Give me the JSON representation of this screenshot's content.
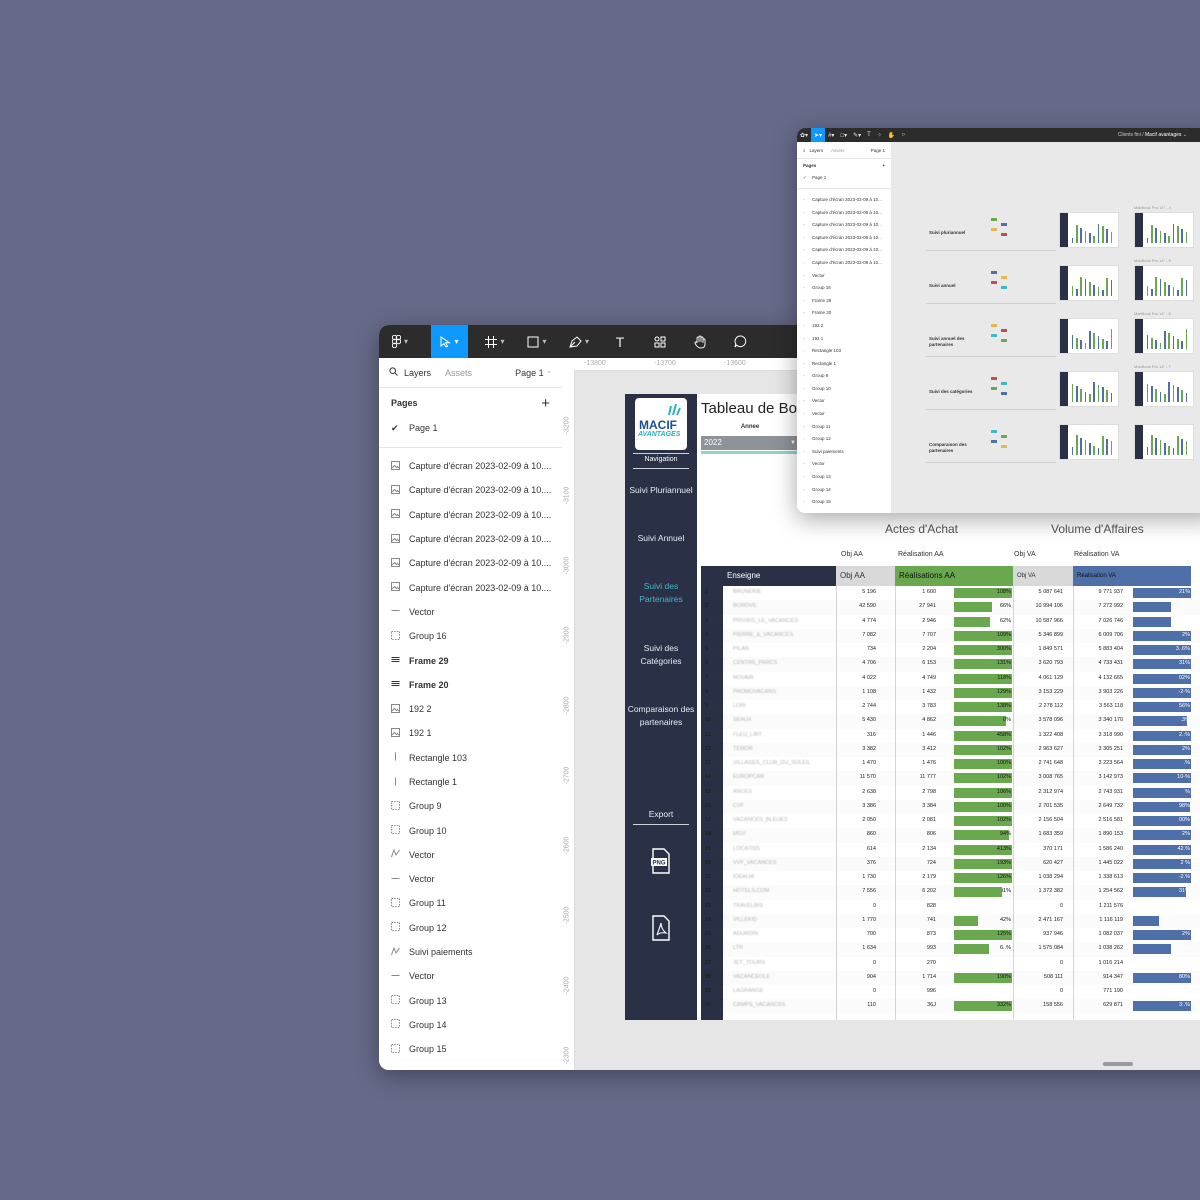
{
  "main_window": {
    "toolbar": {
      "tools": [
        {
          "name": "figma-menu",
          "icon": "figma-logo-icon"
        },
        {
          "name": "move-tool",
          "icon": "cursor-arrow-icon"
        },
        {
          "name": "frame-tool",
          "icon": "frame-hash-icon"
        },
        {
          "name": "shape-tool",
          "icon": "rectangle-icon"
        },
        {
          "name": "pen-tool",
          "icon": "pen-icon"
        },
        {
          "name": "text-tool",
          "label": "T"
        },
        {
          "name": "resources-tool",
          "icon": "components-icon"
        },
        {
          "name": "hand-tool",
          "icon": "hand-icon"
        },
        {
          "name": "comment-tool",
          "icon": "comment-icon"
        }
      ]
    },
    "left_panel": {
      "tab_layers": "Layers",
      "tab_assets": "Assets",
      "page_selector": "Page 1",
      "pages_header": "Pages",
      "pages": [
        "Page 1"
      ],
      "layers": [
        {
          "label": "Capture d'écran 2023-02-09 à 10....",
          "icon": "image-icon",
          "bold": false
        },
        {
          "label": "Capture d'écran 2023-02-09 à 10....",
          "icon": "image-icon",
          "bold": false
        },
        {
          "label": "Capture d'écran 2023-02-09 à 10....",
          "icon": "image-icon",
          "bold": false
        },
        {
          "label": "Capture d'écran 2023-02-09 à 10....",
          "icon": "image-icon",
          "bold": false
        },
        {
          "label": "Capture d'écran 2023-02-09 à 10....",
          "icon": "image-icon",
          "bold": false
        },
        {
          "label": "Capture d'écran 2023-02-09 à 10....",
          "icon": "image-icon",
          "bold": false
        },
        {
          "label": "Vector",
          "icon": "line-icon",
          "bold": false
        },
        {
          "label": "Group 16",
          "icon": "group-icon",
          "bold": false
        },
        {
          "label": "Frame 29",
          "icon": "frame-icon",
          "bold": true
        },
        {
          "label": "Frame 20",
          "icon": "frame-icon",
          "bold": true
        },
        {
          "label": "192 2",
          "icon": "image-icon",
          "bold": false
        },
        {
          "label": "192 1",
          "icon": "image-icon",
          "bold": false
        },
        {
          "label": "Rectangle 103",
          "icon": "rectangle-thin-icon",
          "bold": false
        },
        {
          "label": "Rectangle 1",
          "icon": "rectangle-thin-icon",
          "bold": false
        },
        {
          "label": "Group 9",
          "icon": "group-icon",
          "bold": false
        },
        {
          "label": "Group 10",
          "icon": "group-icon",
          "bold": false
        },
        {
          "label": "Vector",
          "icon": "vector-path-icon",
          "bold": false
        },
        {
          "label": "Vector",
          "icon": "line-icon",
          "bold": false
        },
        {
          "label": "Group 11",
          "icon": "group-icon",
          "bold": false
        },
        {
          "label": "Group 12",
          "icon": "group-icon",
          "bold": false
        },
        {
          "label": "Suivi paiements",
          "icon": "vector-path-icon",
          "bold": false
        },
        {
          "label": "Vector",
          "icon": "line-icon",
          "bold": false
        },
        {
          "label": "Group 13",
          "icon": "group-icon",
          "bold": false
        },
        {
          "label": "Group 14",
          "icon": "group-icon",
          "bold": false
        },
        {
          "label": "Group 15",
          "icon": "group-icon",
          "bold": false
        }
      ]
    },
    "rulers": {
      "top": [
        "-13800",
        "-13700",
        "-13600"
      ],
      "left": [
        "-3200",
        "-3100",
        "-3000",
        "-2900",
        "-2800",
        "-2700",
        "-2600",
        "-2500",
        "-2400",
        "-2300"
      ]
    },
    "dashboard": {
      "logo_line1": "MACIF",
      "logo_line2": "AVANTAGES",
      "title": "Tableau de Bo",
      "year_label": "Annee",
      "year_value": "2022",
      "nav_title": "Navigation",
      "nav_items": [
        {
          "label": "Suivi Pluriannuel",
          "active": false
        },
        {
          "label": "Suivi Annuel",
          "active": false
        },
        {
          "label": "Suivi des Partenaires",
          "active": true
        },
        {
          "label": "Suivi des Catégories",
          "active": false
        },
        {
          "label": "Comparaison des partenaires",
          "active": false
        }
      ],
      "export_label": "Export",
      "export_png_label": "PNG",
      "group_headers": {
        "aa": "Actes d'Achat",
        "va": "Volume d'Affaires"
      },
      "column_headers": {
        "obj_aa": "Obj AA",
        "real_aa": "Réalisation AA",
        "obj_va": "Obj VA",
        "real_va": "Réalisation VA"
      },
      "table_headers": {
        "enseigne": "Enseigne",
        "obj_aa": "Obj AA",
        "real_aa": "Réalisations AA",
        "obj_va": "Obj VA",
        "real_va": "Réalisation VA"
      },
      "colors": {
        "nav": "#2a3147",
        "active_nav": "#40b8c6",
        "aa_bar": "#6aa84f",
        "va_bar": "#4f6fa8",
        "accent": "#8fd6c9"
      },
      "rows": [
        {
          "rank": "1",
          "name": "BRUNERIE",
          "obj_aa": "5 196",
          "real_aa": "1 600",
          "aa_pct": "108%",
          "obj_va": "5 087 641",
          "real_va": "9 771 937",
          "va_pct": "21%"
        },
        {
          "rank": "2",
          "name": "BOROVE",
          "obj_aa": "42 590",
          "real_aa": "27 941",
          "aa_pct": "66%",
          "obj_va": "10 994 106",
          "real_va": "7 272 992",
          "va_pct": "66%"
        },
        {
          "rank": "3",
          "name": "PRIVIEG_LE_VACANCES",
          "obj_aa": "4 774",
          "real_aa": "2 946",
          "aa_pct": "62%",
          "obj_va": "10 587 966",
          "real_va": "7 026 746",
          "va_pct": "66%"
        },
        {
          "rank": "4",
          "name": "PIERRE_&_VACANCES",
          "obj_aa": "7 082",
          "real_aa": "7 707",
          "aa_pct": "109%",
          "obj_va": "5 346 899",
          "real_va": "6 009 706",
          "va_pct": "2%"
        },
        {
          "rank": "5",
          "name": "PILAN",
          "obj_aa": "734",
          "real_aa": "2 204",
          "aa_pct": "300%",
          "obj_va": "1 849 571",
          "real_va": "5 883 404",
          "va_pct": "3..6%"
        },
        {
          "rank": "6",
          "name": "CENTRE_PARCS",
          "obj_aa": "4 706",
          "real_aa": "6 153",
          "aa_pct": "131%",
          "obj_va": "3 620 793",
          "real_va": "4 733 431",
          "va_pct": "31%"
        },
        {
          "rank": "7",
          "name": "NOVAIR",
          "obj_aa": "4 022",
          "real_aa": "4 749",
          "aa_pct": "118%",
          "obj_va": "4 061 129",
          "real_va": "4 132 665",
          "va_pct": "02%"
        },
        {
          "rank": "8",
          "name": "PROMOVACANS",
          "obj_aa": "1 108",
          "real_aa": "1 432",
          "aa_pct": "129%",
          "obj_va": "3 153 229",
          "real_va": "3 903 226",
          "va_pct": "-2-%"
        },
        {
          "rank": "9",
          "name": "LORI",
          "obj_aa": "2 744",
          "real_aa": "3 783",
          "aa_pct": "138%",
          "obj_va": "2 278 112",
          "real_va": "3 563 118",
          "va_pct": "56%"
        },
        {
          "rank": "10",
          "name": "SEAUX",
          "obj_aa": "5 430",
          "real_aa": "4 862",
          "aa_pct": "0%",
          "obj_va": "3 578 096",
          "real_va": "3 340 170",
          "va_pct": ".3%"
        },
        {
          "rank": "11",
          "name": "FLEU_LIBT",
          "obj_aa": "316",
          "real_aa": "1 446",
          "aa_pct": "458%",
          "obj_va": "1 322 408",
          "real_va": "3 318 990",
          "va_pct": "2.:%"
        },
        {
          "rank": "12",
          "name": "TEMOR",
          "obj_aa": "3 382",
          "real_aa": "3 412",
          "aa_pct": "102%",
          "obj_va": "2 963 627",
          "real_va": "3 305 251",
          "va_pct": "2%"
        },
        {
          "rank": "13",
          "name": "VILLAGES_CLUB_DU_SOLEIL",
          "obj_aa": "1 470",
          "real_aa": "1 476",
          "aa_pct": "100%",
          "obj_va": "2 741 648",
          "real_va": "3 223 564",
          "va_pct": ".%"
        },
        {
          "rank": "14",
          "name": "EUROPCAR",
          "obj_aa": "11 570",
          "real_aa": "11 777",
          "aa_pct": "102%",
          "obj_va": "3 008 765",
          "real_va": "3 142 973",
          "va_pct": "10-%"
        },
        {
          "rank": "15",
          "name": "ANCES",
          "obj_aa": "2 638",
          "real_aa": "2 798",
          "aa_pct": "106%",
          "obj_va": "2 312 974",
          "real_va": "2 743 931",
          "va_pct": "%"
        },
        {
          "rank": "16",
          "name": "CVF",
          "obj_aa": "3 386",
          "real_aa": "3 384",
          "aa_pct": "100%",
          "obj_va": "2 701 535",
          "real_va": "2 649 732",
          "va_pct": "98%"
        },
        {
          "rank": "17",
          "name": "VACANCES_BLEUES",
          "obj_aa": "2 050",
          "real_aa": "2 081",
          "aa_pct": "102%",
          "obj_va": "2 156 504",
          "real_va": "2 516 581",
          "va_pct": "00%"
        },
        {
          "rank": "18",
          "name": "MGV",
          "obj_aa": "860",
          "real_aa": "806",
          "aa_pct": "94%",
          "obj_va": "1 683 359",
          "real_va": "1 890 153",
          "va_pct": "2%"
        },
        {
          "rank": "19",
          "name": "LOCATISS",
          "obj_aa": "614",
          "real_aa": "2 134",
          "aa_pct": "413%",
          "obj_va": "370 171",
          "real_va": "1 586 240",
          "va_pct": "42.%"
        },
        {
          "rank": "20",
          "name": "VVF_VACANCES",
          "obj_aa": "376",
          "real_aa": "724",
          "aa_pct": "193%",
          "obj_va": "620 427",
          "real_va": "1 445 022",
          "va_pct": "2 %"
        },
        {
          "rank": "21",
          "name": "IDEALIA",
          "obj_aa": "1 730",
          "real_aa": "2 179",
          "aa_pct": "126%",
          "obj_va": "1 038 294",
          "real_va": "1 338 613",
          "va_pct": "-2.%"
        },
        {
          "rank": "22",
          "name": "HOTELS.COM",
          "obj_aa": "7 556",
          "real_aa": "6 202",
          "aa_pct": "i1%",
          "obj_va": "1 372 382",
          "real_va": "1 254 562",
          "va_pct": "31%"
        },
        {
          "rank": "23",
          "name": "TRAVELBIS",
          "obj_aa": "0",
          "real_aa": "828",
          "aa_pct": "",
          "obj_va": "0",
          "real_va": "1 211 576",
          "va_pct": ""
        },
        {
          "rank": "24",
          "name": "VILLEKID",
          "obj_aa": "1 770",
          "real_aa": "741",
          "aa_pct": "42%",
          "obj_va": "2 471 167",
          "real_va": "1 116 119",
          "va_pct": "45%"
        },
        {
          "rank": "25",
          "name": "ADURDIN",
          "obj_aa": "700",
          "real_aa": "873",
          "aa_pct": "125%",
          "obj_va": "937 946",
          "real_va": "1 082 037",
          "va_pct": "2%"
        },
        {
          "rank": "26",
          "name": "LTR",
          "obj_aa": "1 634",
          "real_aa": "993",
          "aa_pct": "6..%",
          "obj_va": "1 575 084",
          "real_va": "1 038 262",
          "va_pct": "66%"
        },
        {
          "rank": "27",
          "name": "JET_TOURS",
          "obj_aa": "0",
          "real_aa": "270",
          "aa_pct": "",
          "obj_va": "0",
          "real_va": "1 016 214",
          "va_pct": ""
        },
        {
          "rank": "28",
          "name": "VACANCEOLE",
          "obj_aa": "904",
          "real_aa": "1 714",
          "aa_pct": "190%",
          "obj_va": "508 111",
          "real_va": "914 347",
          "va_pct": "80%"
        },
        {
          "rank": "29",
          "name": "LAGRANGE",
          "obj_aa": "0",
          "real_aa": "996",
          "aa_pct": "",
          "obj_va": "0",
          "real_va": "771 190",
          "va_pct": ""
        },
        {
          "rank": "30",
          "name": "CAMPS_VACANCES",
          "obj_aa": "110",
          "real_aa": "36J",
          "aa_pct": "332%",
          "obj_va": "158 556",
          "real_va": "629 871",
          "va_pct": "3:.%"
        }
      ],
      "aa_fill": [
        1.0,
        0.66,
        0.62,
        1.0,
        1.0,
        1.0,
        1.0,
        1.0,
        1.0,
        0.9,
        1.0,
        1.0,
        1.0,
        1.0,
        1.0,
        1.0,
        1.0,
        0.94,
        1.0,
        1.0,
        1.0,
        0.82,
        0,
        0.42,
        1.0,
        0.6,
        0,
        1.0,
        0,
        1.0
      ],
      "va_fill": [
        1.0,
        0.66,
        0.66,
        1.0,
        1.0,
        1.0,
        1.0,
        1.0,
        1.0,
        0.93,
        1.0,
        1.0,
        1.0,
        1.0,
        1.0,
        0.98,
        1.0,
        1.0,
        1.0,
        1.0,
        1.0,
        0.91,
        0,
        0.45,
        1.0,
        0.66,
        0,
        1.0,
        0,
        1.0
      ]
    }
  },
  "secondary_window": {
    "breadcrumb_team": "Clients fini",
    "breadcrumb_file": "Macif avantages",
    "tab_layers": "Layers",
    "tab_assets": "Assets",
    "page_selector": "Page 1",
    "pages_header": "Pages",
    "pages": [
      "Page 1"
    ],
    "layers": [
      "Capture d'écran 2023-02-09 à 10...",
      "Capture d'écran 2023-02-09 à 10...",
      "Capture d'écran 2023-02-09 à 10...",
      "Capture d'écran 2023-02-09 à 10...",
      "Capture d'écran 2023-02-09 à 10...",
      "Capture d'écran 2023-02-09 à 10...",
      "Vector",
      "Group 16",
      "Frame 29",
      "Frame 20",
      "192 2",
      "192 1",
      "Rectangle 103",
      "Rectangle 1",
      "Group 9",
      "Group 10",
      "Vector",
      "Vector",
      "Group 11",
      "Group 12",
      "Suivi paiements",
      "Vector",
      "Group 13",
      "Group 14",
      "Group 15"
    ],
    "sections": [
      "Suivi pluriannuel",
      "Suivi annuel",
      "Suivi annuel des partenaires",
      "Suivi des catégories",
      "Comparaison des partenaires"
    ],
    "frame_labels": [
      "MacBook Pro 14\" - 4",
      "MacBook Pro 14\" - 5",
      "MacBook Pro 14\" - 6",
      "MacBook Pro 14\" - 7"
    ]
  }
}
